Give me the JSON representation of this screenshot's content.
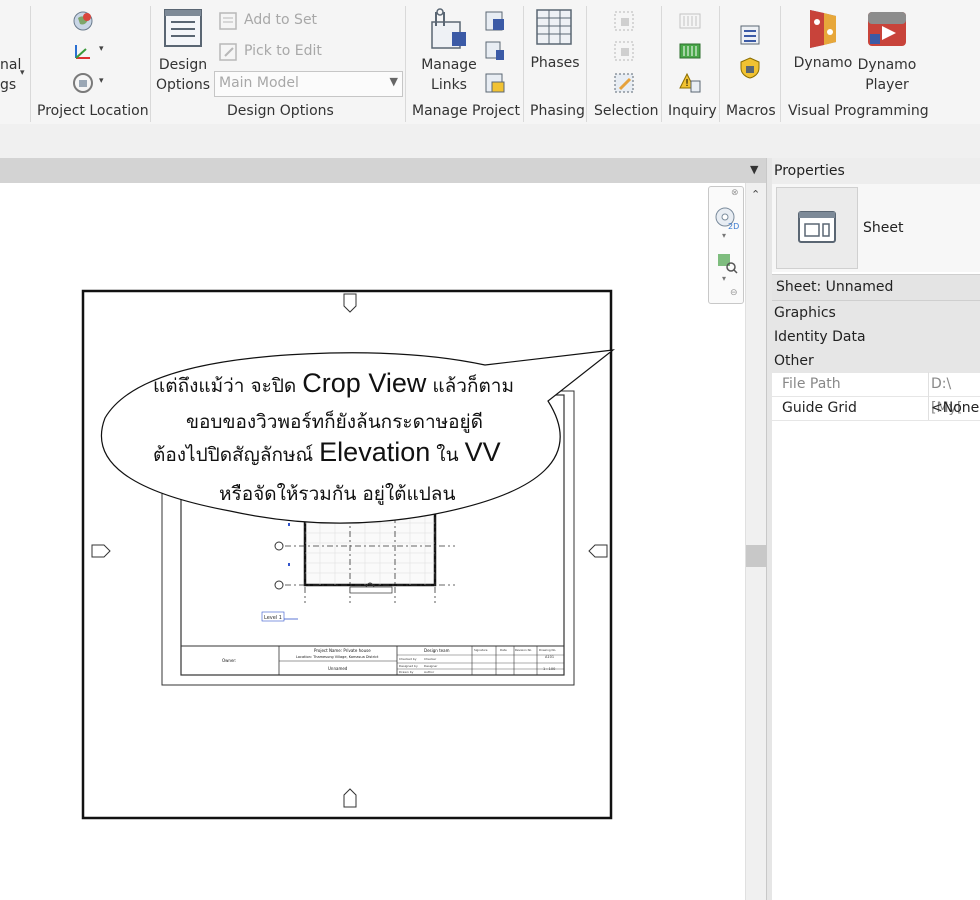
{
  "ribbon": {
    "cut_label_line1": "nal",
    "cut_label_line2": "gs",
    "panels": {
      "project_location": "Project Location",
      "design_options": "Design Options",
      "manage_project": "Manage Project",
      "phasing": "Phasing",
      "selection": "Selection",
      "inquiry": "Inquiry",
      "macros": "Macros",
      "visual_programming": "Visual Programming"
    },
    "design_options_button": {
      "line1": "Design",
      "line2": "Options"
    },
    "add_to_set": "Add to Set",
    "pick_to_edit": "Pick to Edit",
    "main_model_select": "Main Model",
    "manage_links": {
      "line1": "Manage",
      "line2": "Links"
    },
    "phases": "Phases",
    "dynamo": "Dynamo",
    "dynamo_player": {
      "line1": "Dynamo",
      "line2": "Player"
    }
  },
  "properties": {
    "title": "Properties",
    "type_name": "Sheet",
    "instance_selector": "Sheet: Unnamed",
    "groups": [
      "Graphics",
      "Identity Data",
      "Other"
    ],
    "rows": [
      {
        "name": "File Path",
        "value": "D:\\[My["
      },
      {
        "name": "Guide Grid",
        "value": "<None>"
      }
    ]
  },
  "bubble": {
    "line1_a": "แต่ถึงแม้ว่า จะปิด ",
    "line1_b": "Crop View",
    "line1_c": " แล้วก็ตาม",
    "line2": "ขอบของวิวพอร์ทก็ยังล้นกระดาษอยู่ดี",
    "line3_a": "ต้องไปปิดสัญลักษณ์ ",
    "line3_b": "Elevation",
    "line3_c": " ใน ",
    "line3_d": "VV",
    "line4": "หรือจัดให้รวมกัน อยู่ใต้แปลน"
  },
  "sheet": {
    "level_tag": "Level 1",
    "owner_label": "Owner:",
    "project_name": "Project Name: Private house",
    "location": "Location: Thamesung Village, Komasua District",
    "sheet_name": "Unnamed",
    "design_team": "Design team",
    "team_rows": [
      "Checked by",
      "Designed by",
      "Drawn by"
    ],
    "team_values": [
      "Checker",
      "Designer",
      "Author"
    ],
    "signature": "Signature",
    "date": "Date",
    "revision_no": "Revision No",
    "drawing_no": "Drawing No.",
    "drawing_no_value": "A101",
    "scale_value": "1 : 100"
  },
  "colors": {
    "ribbon_bg": "#f5f5f5",
    "view_bar": "#d3d3d3",
    "dynamo_blue": "#3b5aa6",
    "dynamo_red": "#c8433a"
  }
}
